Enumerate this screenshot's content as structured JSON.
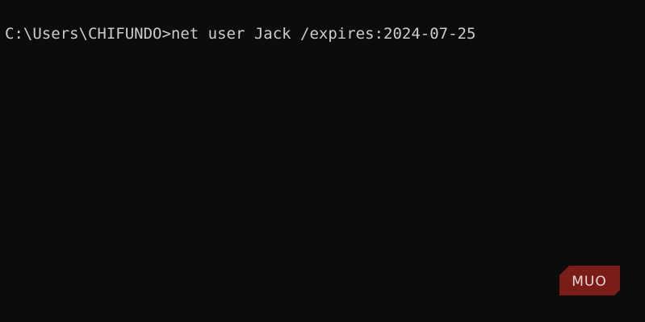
{
  "console": {
    "prompt": "C:\\Users\\CHIFUNDO>",
    "command": "net user Jack /expires:2024-07-25"
  },
  "watermark": {
    "text": "MUO",
    "color": "#7a1c17"
  },
  "colors": {
    "background": "#0c0c0c",
    "foreground": "#cccccc"
  }
}
